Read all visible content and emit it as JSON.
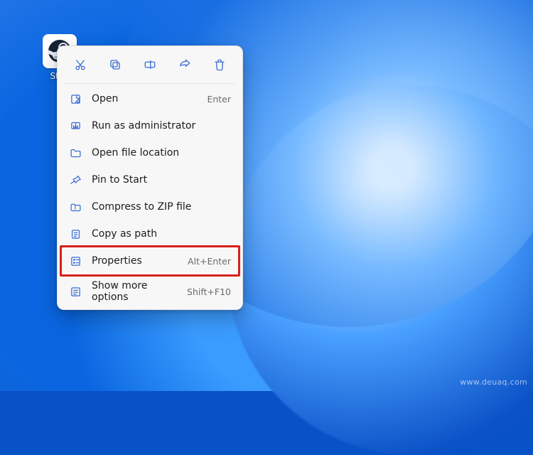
{
  "desktop": {
    "icon": {
      "label": "Stea",
      "graphic": "steam-logo"
    }
  },
  "context_menu": {
    "quick_actions": [
      {
        "name": "cut-icon"
      },
      {
        "name": "copy-icon"
      },
      {
        "name": "rename-icon"
      },
      {
        "name": "share-icon"
      },
      {
        "name": "delete-icon"
      }
    ],
    "items": [
      {
        "icon": "open-icon",
        "label": "Open",
        "shortcut": "Enter"
      },
      {
        "icon": "shield-icon",
        "label": "Run as administrator",
        "shortcut": ""
      },
      {
        "icon": "folder-icon",
        "label": "Open file location",
        "shortcut": ""
      },
      {
        "icon": "pin-icon",
        "label": "Pin to Start",
        "shortcut": ""
      },
      {
        "icon": "zip-icon",
        "label": "Compress to ZIP file",
        "shortcut": ""
      },
      {
        "icon": "copy-path-icon",
        "label": "Copy as path",
        "shortcut": ""
      },
      {
        "icon": "properties-icon",
        "label": "Properties",
        "shortcut": "Alt+Enter",
        "highlighted": true
      },
      {
        "icon": "more-icon",
        "label": "Show more options",
        "shortcut": "Shift+F10"
      }
    ],
    "separator_after_index": 6
  },
  "colors": {
    "menu_bg": "#f8f7f7",
    "icon_tint": "#3a6fd8",
    "highlight_border": "#d8201a"
  },
  "watermark": "www.deuaq.com"
}
